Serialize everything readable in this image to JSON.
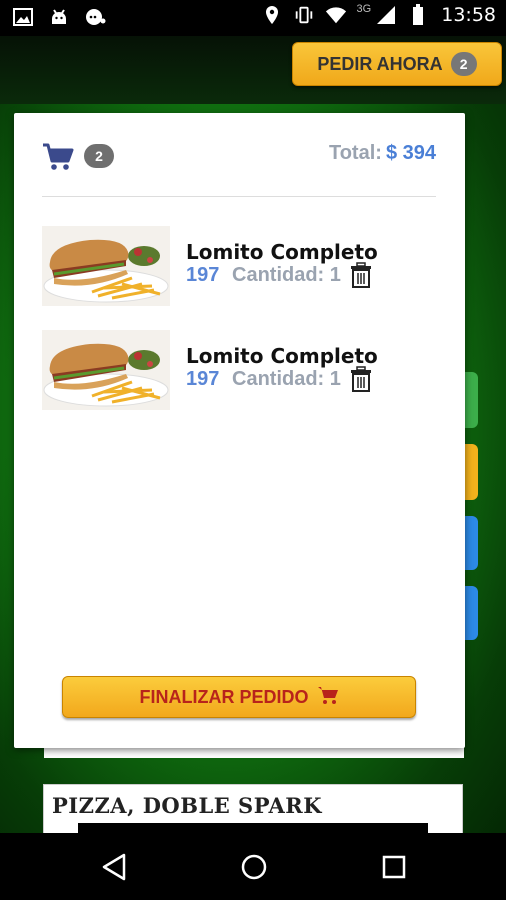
{
  "status_bar": {
    "time": "13:58",
    "network": "3G",
    "left_icons": [
      "image-icon",
      "android-icon",
      "chat-icon"
    ],
    "right_icons": [
      "location-icon",
      "vibrate-icon",
      "wifi-icon",
      "signal-icon",
      "battery-icon"
    ]
  },
  "header": {
    "pedir_label": "PEDIR AHORA",
    "pedir_count": "2"
  },
  "cart": {
    "count": "2",
    "total_label": "Total:",
    "total_value": "$ 394",
    "items": [
      {
        "name": "Lomito Completo",
        "price": "197",
        "qty_label": "Cantidad: 1"
      },
      {
        "name": "Lomito Completo",
        "price": "197",
        "qty_label": "Cantidad: 1"
      }
    ],
    "finalize_label": "FINALIZAR PEDIDO"
  },
  "background": {
    "pizza_title": "PIZZA, DOBLE SPARK"
  },
  "colors": {
    "accent": "#f0a81a",
    "price": "#5a86d6",
    "finalize_text": "#b8231b",
    "background_green": "#1fa31c"
  }
}
